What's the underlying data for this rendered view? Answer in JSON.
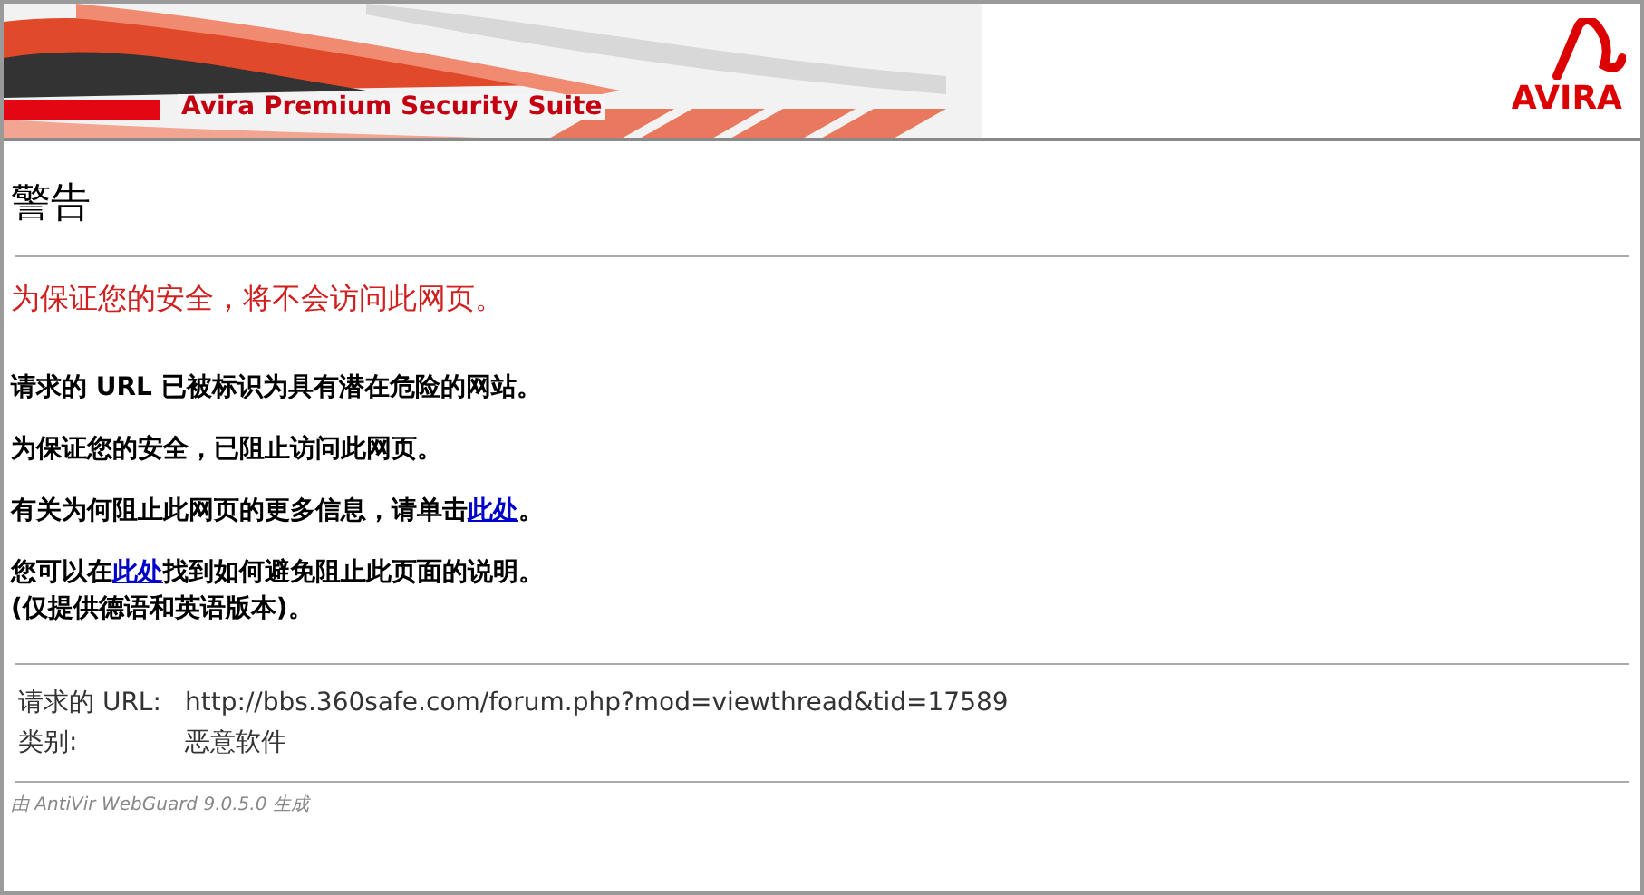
{
  "banner": {
    "product": "Avira Premium Security Suite",
    "logo": "AVIRA"
  },
  "title": "警告",
  "alert": "为保证您的安全，将不会访问此网页。",
  "paragraphs": [
    {
      "parts": [
        {
          "text": "请求的 URL 已被标识为具有潜在危险的网站。",
          "link": false
        }
      ]
    },
    {
      "parts": [
        {
          "text": "为保证您的安全，已阻止访问此网页。",
          "link": false
        }
      ]
    },
    {
      "parts": [
        {
          "text": "有关为何阻止此网页的更多信息，请单击",
          "link": false
        },
        {
          "text": "此处",
          "link": true
        },
        {
          "text": "。",
          "link": false
        }
      ]
    },
    {
      "parts": [
        {
          "text": "您可以在",
          "link": false
        },
        {
          "text": "此处",
          "link": true
        },
        {
          "text": "找到如何避免阻止此页面的说明。",
          "link": false
        }
      ],
      "note": "(仅提供德语和英语版本)。"
    }
  ],
  "details": [
    {
      "label": "请求的 URL:",
      "value": "http://bbs.360safe.com/forum.php?mod=viewthread&tid=17589"
    },
    {
      "label": "类别:",
      "value": "恶意软件"
    }
  ],
  "footer": "由 AntiVir WebGuard 9.0.5.0 生成"
}
